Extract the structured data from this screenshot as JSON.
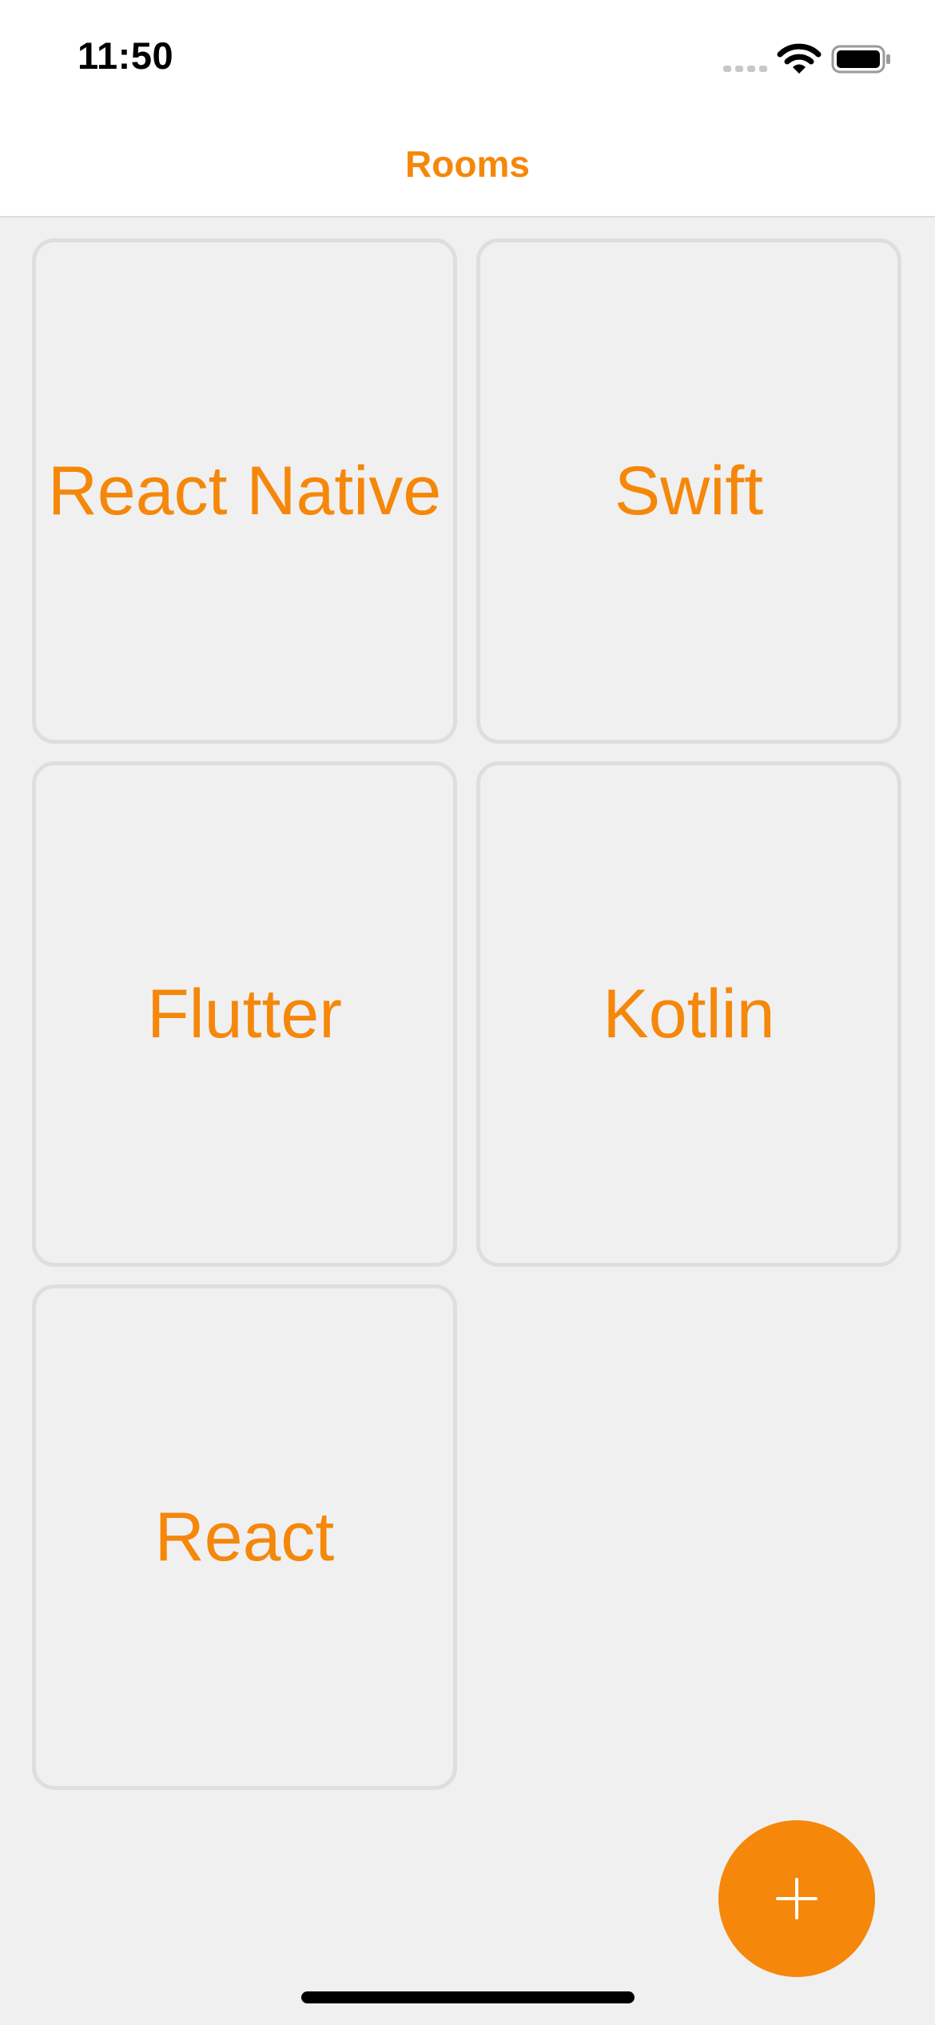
{
  "status_bar": {
    "time": "11:50",
    "icons": [
      "cellular-signal-icon",
      "wifi-icon",
      "battery-icon"
    ]
  },
  "header": {
    "title": "Rooms"
  },
  "rooms": [
    {
      "name": "React Native"
    },
    {
      "name": "Swift"
    },
    {
      "name": "Flutter"
    },
    {
      "name": "Kotlin"
    },
    {
      "name": "React"
    }
  ],
  "fab": {
    "icon": "plus-icon"
  },
  "colors": {
    "accent": "#f5870a",
    "background": "#f0f0f0",
    "card_border": "#dedede",
    "header_background": "#ffffff"
  }
}
